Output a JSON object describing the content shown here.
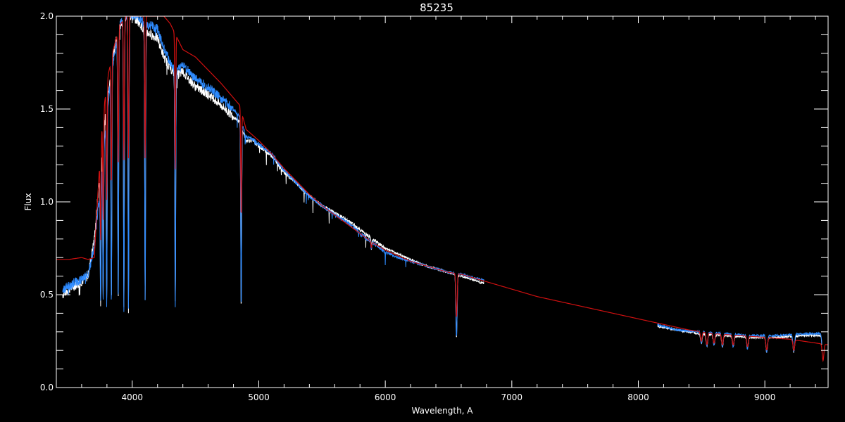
{
  "chart_data": {
    "type": "line",
    "title": "85235",
    "xlabel": "Wavelength, A",
    "ylabel": "Flux",
    "xlim": [
      3400,
      9500
    ],
    "ylim": [
      0.0,
      2.0
    ],
    "xticks": [
      4000,
      5000,
      6000,
      7000,
      8000,
      9000
    ],
    "yticks": [
      0.0,
      0.5,
      1.0,
      1.5,
      2.0
    ],
    "xtick_labels": [
      "4000",
      "5000",
      "6000",
      "7000",
      "8000",
      "9000"
    ],
    "ytick_labels": [
      "0.0",
      "0.5",
      "1.0",
      "1.5",
      "2.0"
    ],
    "xminor_step": 200,
    "yminor_step": 0.1,
    "grid": false,
    "background": "#000000",
    "axis_color": "#ffffff",
    "series": [
      {
        "color": "#ffffff",
        "role": "observed spectrum (white)",
        "segments": [
          [
            [
              3450,
              0.5
            ],
            [
              3500,
              0.53
            ],
            [
              3550,
              0.55
            ],
            [
              3600,
              0.57
            ],
            [
              3650,
              0.6
            ],
            [
              3700,
              0.8
            ],
            [
              3750,
              1.2
            ],
            [
              3800,
              1.55
            ],
            [
              3850,
              1.8
            ],
            [
              3900,
              1.95
            ],
            [
              3950,
              2.0
            ],
            [
              4000,
              2.0
            ],
            [
              4050,
              1.97
            ],
            [
              4100,
              1.92
            ],
            [
              4150,
              1.9
            ],
            [
              4200,
              1.88
            ],
            [
              4250,
              1.78
            ],
            [
              4300,
              1.72
            ],
            [
              4350,
              1.68
            ],
            [
              4400,
              1.7
            ],
            [
              4450,
              1.66
            ],
            [
              4500,
              1.62
            ],
            [
              4600,
              1.58
            ],
            [
              4700,
              1.52
            ],
            [
              4800,
              1.46
            ],
            [
              4850,
              1.43
            ],
            [
              4900,
              1.33
            ],
            [
              4950,
              1.33
            ],
            [
              5000,
              1.3
            ],
            [
              5100,
              1.25
            ],
            [
              5200,
              1.16
            ],
            [
              5300,
              1.1
            ],
            [
              5400,
              1.03
            ],
            [
              5500,
              0.98
            ],
            [
              5600,
              0.94
            ],
            [
              5700,
              0.9
            ],
            [
              5800,
              0.85
            ],
            [
              5900,
              0.8
            ],
            [
              6000,
              0.75
            ],
            [
              6100,
              0.72
            ],
            [
              6200,
              0.69
            ],
            [
              6300,
              0.66
            ],
            [
              6400,
              0.64
            ],
            [
              6500,
              0.62
            ],
            [
              6600,
              0.6
            ],
            [
              6700,
              0.58
            ],
            [
              6780,
              0.56
            ]
          ],
          [
            [
              8150,
              0.33
            ],
            [
              8300,
              0.31
            ],
            [
              8500,
              0.29
            ],
            [
              8700,
              0.28
            ],
            [
              8900,
              0.27
            ],
            [
              9100,
              0.27
            ],
            [
              9300,
              0.28
            ],
            [
              9450,
              0.28
            ]
          ]
        ]
      },
      {
        "color": "#2e8bff",
        "role": "observed spectrum (blue)",
        "segments": [
          [
            [
              3450,
              0.52
            ],
            [
              3500,
              0.55
            ],
            [
              3550,
              0.57
            ],
            [
              3600,
              0.58
            ],
            [
              3650,
              0.61
            ],
            [
              3700,
              0.75
            ],
            [
              3750,
              1.1
            ],
            [
              3800,
              1.5
            ],
            [
              3850,
              1.75
            ],
            [
              3900,
              1.95
            ],
            [
              3950,
              2.0
            ],
            [
              4000,
              2.0
            ],
            [
              4050,
              2.0
            ],
            [
              4100,
              1.95
            ],
            [
              4150,
              1.95
            ],
            [
              4200,
              1.93
            ],
            [
              4250,
              1.83
            ],
            [
              4300,
              1.75
            ],
            [
              4350,
              1.7
            ],
            [
              4400,
              1.74
            ],
            [
              4450,
              1.7
            ],
            [
              4500,
              1.66
            ],
            [
              4600,
              1.62
            ],
            [
              4700,
              1.56
            ],
            [
              4800,
              1.5
            ],
            [
              4850,
              1.46
            ],
            [
              4900,
              1.35
            ],
            [
              4950,
              1.34
            ],
            [
              5000,
              1.31
            ],
            [
              5100,
              1.26
            ],
            [
              5200,
              1.17
            ],
            [
              5300,
              1.1
            ],
            [
              5400,
              1.03
            ],
            [
              5500,
              0.98
            ],
            [
              5600,
              0.93
            ],
            [
              5700,
              0.89
            ],
            [
              5800,
              0.83
            ],
            [
              5900,
              0.78
            ],
            [
              6000,
              0.73
            ],
            [
              6100,
              0.7
            ],
            [
              6200,
              0.68
            ],
            [
              6300,
              0.66
            ],
            [
              6400,
              0.64
            ],
            [
              6500,
              0.62
            ],
            [
              6600,
              0.61
            ],
            [
              6700,
              0.59
            ],
            [
              6780,
              0.58
            ]
          ],
          [
            [
              8150,
              0.34
            ],
            [
              8300,
              0.31
            ],
            [
              8500,
              0.3
            ],
            [
              8700,
              0.29
            ],
            [
              8900,
              0.28
            ],
            [
              9100,
              0.28
            ],
            [
              9300,
              0.29
            ],
            [
              9450,
              0.29
            ]
          ]
        ]
      },
      {
        "color": "#d01010",
        "role": "model spectrum (red)",
        "segments": [
          [
            [
              3400,
              0.69
            ],
            [
              3500,
              0.69
            ],
            [
              3600,
              0.7
            ],
            [
              3650,
              0.69
            ],
            [
              3700,
              0.7
            ],
            [
              3720,
              0.95
            ],
            [
              3760,
              1.4
            ],
            [
              3800,
              1.65
            ],
            [
              3850,
              1.82
            ],
            [
              3900,
              1.95
            ],
            [
              3950,
              2.0
            ],
            [
              4000,
              2.0
            ],
            [
              4100,
              2.0
            ],
            [
              4150,
              2.0
            ],
            [
              4200,
              2.0
            ],
            [
              4250,
              2.0
            ],
            [
              4300,
              1.96
            ],
            [
              4400,
              1.82
            ],
            [
              4500,
              1.78
            ],
            [
              4600,
              1.71
            ],
            [
              4700,
              1.64
            ],
            [
              4800,
              1.56
            ],
            [
              4850,
              1.52
            ],
            [
              4900,
              1.39
            ],
            [
              5000,
              1.33
            ],
            [
              5100,
              1.26
            ],
            [
              5200,
              1.18
            ],
            [
              5300,
              1.11
            ],
            [
              5400,
              1.04
            ],
            [
              5500,
              0.98
            ],
            [
              5600,
              0.93
            ],
            [
              5700,
              0.88
            ],
            [
              5800,
              0.83
            ],
            [
              5900,
              0.78
            ],
            [
              6000,
              0.74
            ],
            [
              6100,
              0.71
            ],
            [
              6200,
              0.68
            ],
            [
              6300,
              0.66
            ],
            [
              6400,
              0.64
            ],
            [
              6500,
              0.62
            ],
            [
              6600,
              0.61
            ],
            [
              6700,
              0.59
            ],
            [
              6800,
              0.57
            ],
            [
              7000,
              0.53
            ],
            [
              7200,
              0.49
            ],
            [
              7400,
              0.46
            ],
            [
              7600,
              0.43
            ],
            [
              7800,
              0.4
            ],
            [
              8000,
              0.37
            ],
            [
              8200,
              0.34
            ],
            [
              8400,
              0.31
            ],
            [
              8600,
              0.29
            ],
            [
              8800,
              0.28
            ],
            [
              9000,
              0.27
            ],
            [
              9200,
              0.26
            ],
            [
              9400,
              0.24
            ],
            [
              9500,
              0.23
            ]
          ]
        ]
      },
      {
        "color": "#2e8bff",
        "role": "baseline near zero",
        "segments": [
          [
            [
              3450,
              0.0
            ],
            [
              6800,
              0.0
            ]
          ],
          [
            [
              8150,
              0.0
            ],
            [
              9500,
              0.0
            ]
          ]
        ]
      }
    ],
    "absorption_lines": [
      {
        "center": 3750,
        "depth_to": 0.45
      },
      {
        "center": 3770,
        "depth_to": 0.48
      },
      {
        "center": 3798,
        "depth_to": 0.45
      },
      {
        "center": 3835,
        "depth_to": 0.45
      },
      {
        "center": 3889,
        "depth_to": 0.46
      },
      {
        "center": 3934,
        "depth_to": 0.42
      },
      {
        "center": 3970,
        "depth_to": 0.42
      },
      {
        "center": 4102,
        "depth_to": 0.45
      },
      {
        "center": 4340,
        "depth_to": 0.45
      },
      {
        "center": 4861,
        "depth_to": 0.42
      },
      {
        "center": 5890,
        "depth_to": 0.75
      },
      {
        "center": 6563,
        "depth_to": 0.27
      },
      {
        "center": 8498,
        "depth_to": 0.24
      },
      {
        "center": 8542,
        "depth_to": 0.22
      },
      {
        "center": 8598,
        "depth_to": 0.23
      },
      {
        "center": 8665,
        "depth_to": 0.22
      },
      {
        "center": 8750,
        "depth_to": 0.22
      },
      {
        "center": 8863,
        "depth_to": 0.21
      },
      {
        "center": 9015,
        "depth_to": 0.19
      },
      {
        "center": 9229,
        "depth_to": 0.19
      },
      {
        "center": 9460,
        "depth_to": 0.11
      }
    ]
  }
}
